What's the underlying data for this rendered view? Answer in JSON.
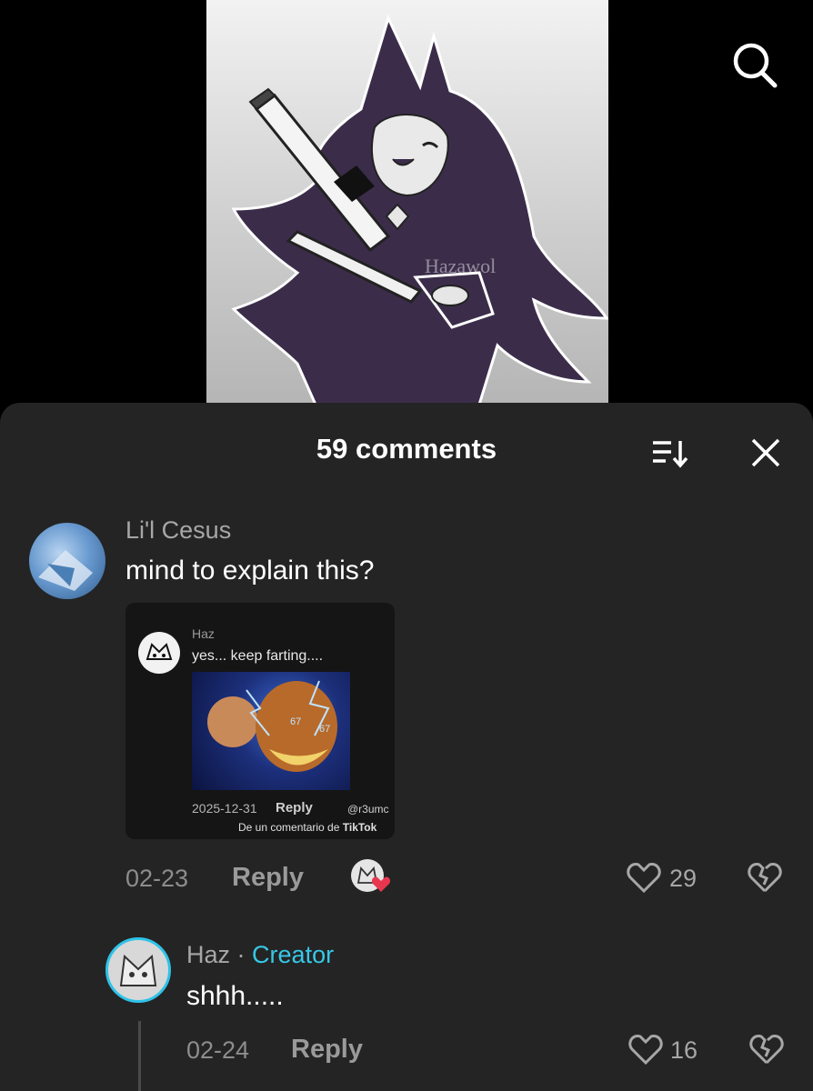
{
  "video": {
    "watermark": "Hazawol"
  },
  "comments_panel": {
    "title": "59 comments",
    "sort_icon": "sort-icon",
    "close_icon": "close-icon"
  },
  "comments": [
    {
      "username": "Li'l Cesus",
      "text": "mind to explain this?",
      "date": "02-23",
      "reply_label": "Reply",
      "likes": "29",
      "embed": {
        "username": "Haz",
        "text": "yes... keep farting....",
        "image_tags": [
          "67",
          "67"
        ],
        "date": "2025-12-31",
        "reply_label": "Reply",
        "handle": "@r3umc",
        "source_text": "De un comentario de",
        "source_brand": "TikTok"
      }
    }
  ],
  "replies": [
    {
      "username": "Haz",
      "separator": "·",
      "badge": "Creator",
      "text": "shhh.....",
      "date": "02-24",
      "reply_label": "Reply",
      "likes": "16"
    }
  ],
  "colors": {
    "sheet_bg": "#242424",
    "creator_badge": "#37c8e8",
    "like_reaction": "#e8364f"
  }
}
